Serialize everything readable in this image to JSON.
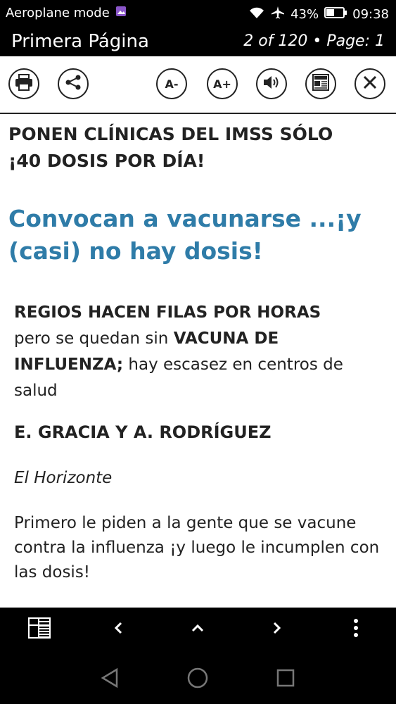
{
  "status": {
    "mode": "Aeroplane mode",
    "battery": "43%",
    "time": "09:38"
  },
  "header": {
    "title": "Primera Página",
    "pages": "2 of 120 • Page: 1"
  },
  "toolbar": {
    "font_smaller": "A-",
    "font_larger": "A+"
  },
  "article": {
    "headline_line1": "PONEN CLÍNICAS DEL IMSS SÓLO",
    "headline_line2": "¡40 DOSIS POR DÍA!",
    "subhead_line1": "Convocan a vacunarse ...¡y",
    "subhead_line2": "(casi) no hay dosis!",
    "para_bold1": "REGIOS HACEN FILAS POR HORAS",
    "para_text1": "pero se quedan sin",
    "para_bold2": "VACUNA DE INFLUENZA;",
    "para_text2": "hay escasez en centros de salud",
    "byline": "E. GRACIA Y A. RODRÍGUEZ",
    "source": "El Horizonte",
    "body": "Primero le piden a la gente que se vacune contra la influenza ¡y luego le incumplen con las dosis!"
  }
}
